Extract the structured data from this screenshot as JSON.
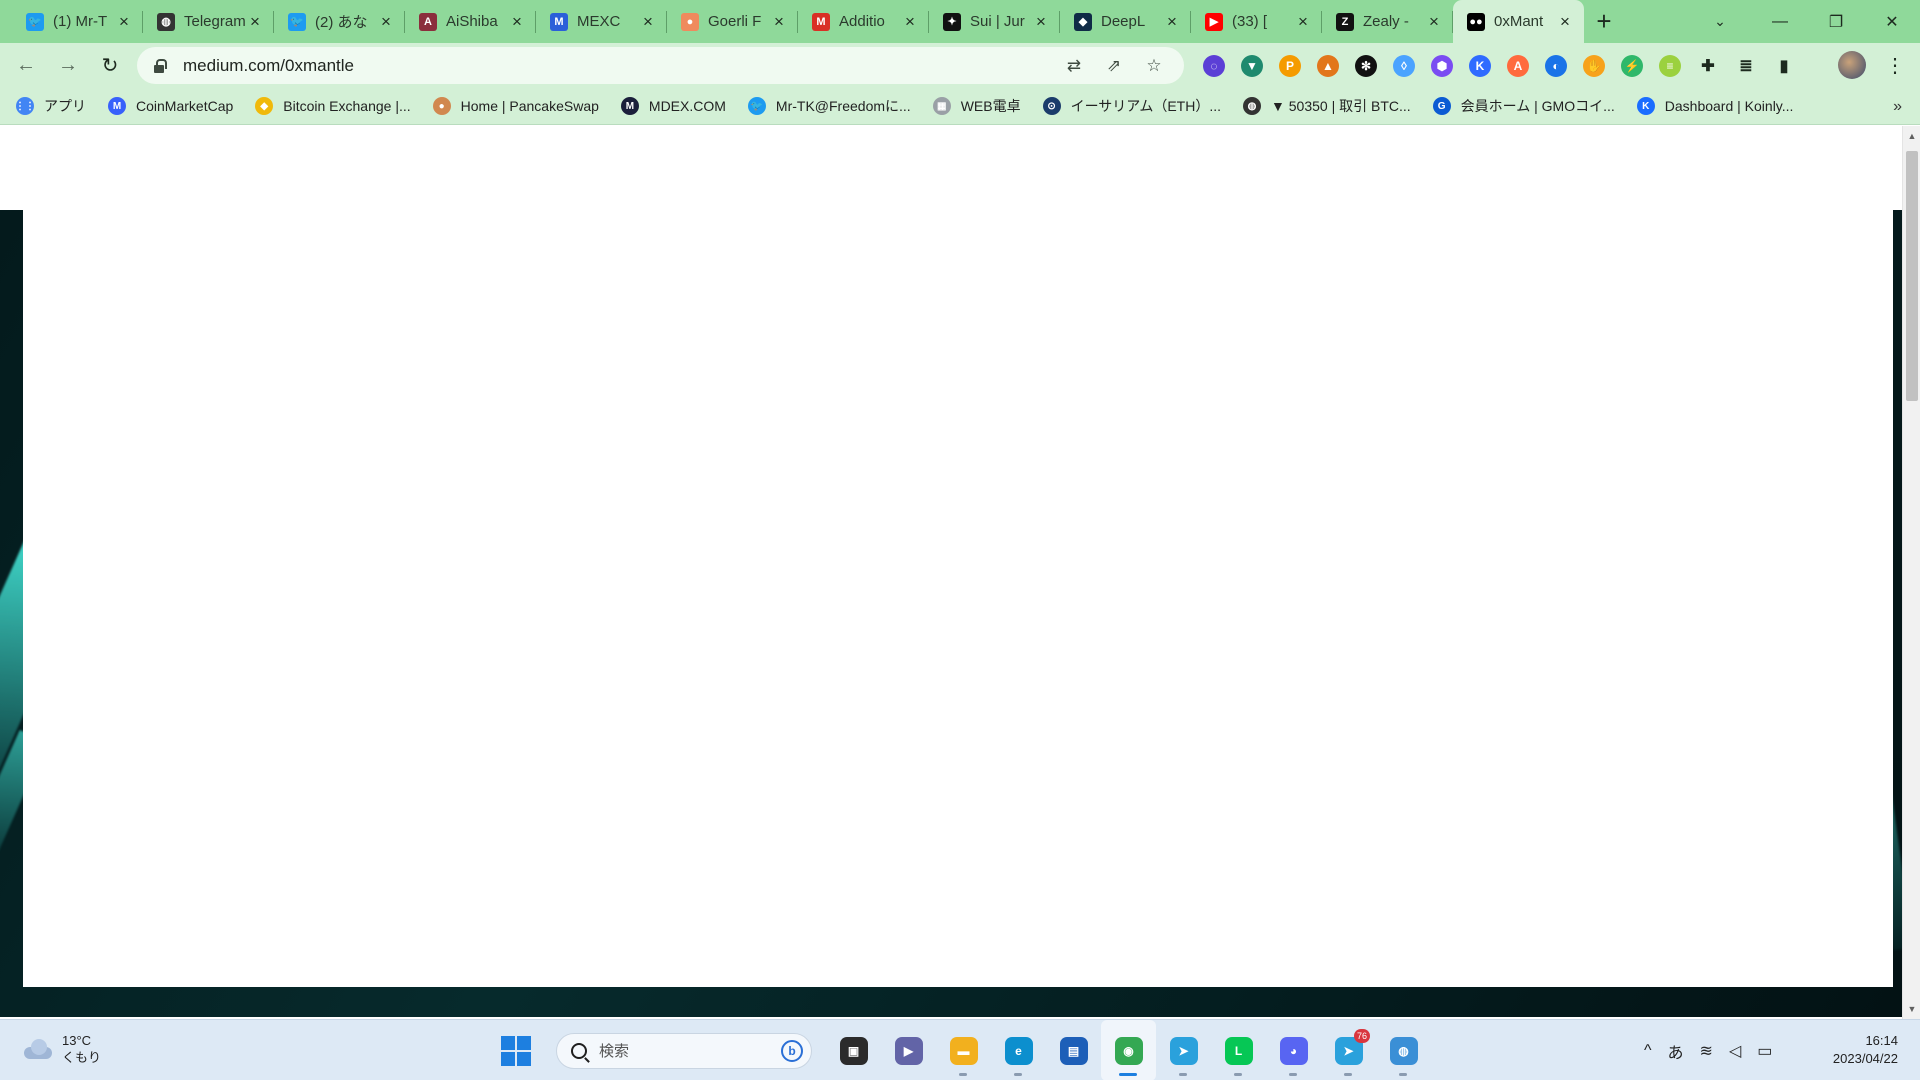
{
  "browser": {
    "tabs": [
      {
        "label": "(1) Mr-T",
        "icon": "twitter-icon",
        "color": "#1d9bf0",
        "glyph": "🐦"
      },
      {
        "label": "Telegram",
        "icon": "globe-icon",
        "color": "#333333",
        "glyph": "◍"
      },
      {
        "label": "(2) あな",
        "icon": "twitter-icon",
        "color": "#1d9bf0",
        "glyph": "🐦"
      },
      {
        "label": "AiShiba",
        "icon": "aishiba-icon",
        "color": "#8b2e3c",
        "glyph": "A"
      },
      {
        "label": "MEXC",
        "icon": "mexc-icon",
        "color": "#2b5fd9",
        "glyph": "M"
      },
      {
        "label": "Goerli F",
        "icon": "faucet-icon",
        "color": "#f08a5d",
        "glyph": "●"
      },
      {
        "label": "Additio",
        "icon": "gmail-icon",
        "color": "#d93025",
        "glyph": "M"
      },
      {
        "label": "Sui | Jur",
        "icon": "sui-icon",
        "color": "#111111",
        "glyph": "✦"
      },
      {
        "label": "DeepL",
        "icon": "deepl-icon",
        "color": "#0f2b46",
        "glyph": "◆"
      },
      {
        "label": "(33) [",
        "icon": "youtube-icon",
        "color": "#ff0000",
        "glyph": "▶"
      },
      {
        "label": "Zealy -",
        "icon": "zealy-icon",
        "color": "#111111",
        "glyph": "Z"
      },
      {
        "label": "0xMant",
        "icon": "medium-icon",
        "color": "#000000",
        "glyph": "●●",
        "active": true
      }
    ],
    "new_tab": "+",
    "tab_search": "⌄",
    "window_controls": {
      "minimize": "—",
      "maximize": "❐",
      "close": "✕"
    }
  },
  "toolbar": {
    "back": "←",
    "forward": "→",
    "reload": "↻",
    "url": "medium.com/0xmantle",
    "omni_actions": [
      "translate-icon",
      "share-icon",
      "bookmark-star-icon"
    ],
    "omni_glyphs": [
      "⇄",
      "⇗",
      "☆"
    ],
    "extensions": [
      {
        "name": "ext-purple-ring-icon",
        "color": "#5b3fd6",
        "glyph": "◌"
      },
      {
        "name": "ext-fox-icon",
        "color": "#1e8a6e",
        "glyph": "▼"
      },
      {
        "name": "ext-orange-p-icon",
        "color": "#f59b00",
        "glyph": "P"
      },
      {
        "name": "metamask-icon",
        "color": "#e2761b",
        "glyph": "▲"
      },
      {
        "name": "ext-black-asterisk-icon",
        "color": "#111111",
        "glyph": "✻"
      },
      {
        "name": "ext-drop-icon",
        "color": "#4aa3ff",
        "glyph": "◊"
      },
      {
        "name": "ext-violet-hex-icon",
        "color": "#7a4cf2",
        "glyph": "⬢"
      },
      {
        "name": "keplr-icon",
        "color": "#2f6bff",
        "glyph": "K"
      },
      {
        "name": "ext-a-icon",
        "color": "#ff6a3d",
        "glyph": "A"
      },
      {
        "name": "ext-blue-orb-icon",
        "color": "#1a73e8",
        "glyph": "◐"
      },
      {
        "name": "ext-hand-icon",
        "color": "#f7a21b",
        "glyph": "✋"
      },
      {
        "name": "ext-lightning-icon",
        "color": "#2fb86a",
        "glyph": "⚡"
      },
      {
        "name": "ext-layer-icon",
        "color": "#9bd13e",
        "glyph": "≡"
      },
      {
        "name": "extensions-puzzle-icon",
        "color": "#1d2a1f",
        "glyph": "✚"
      },
      {
        "name": "media-queue-icon",
        "color": "#1d2a1f",
        "glyph": "≣"
      },
      {
        "name": "side-panel-icon",
        "color": "#1d2a1f",
        "glyph": "▮"
      }
    ],
    "menu": "⋮"
  },
  "bookmarks": [
    {
      "label": "アプリ",
      "icon": "apps-grid-icon",
      "color": "#4285f4",
      "glyph": "⋮⋮"
    },
    {
      "label": "CoinMarketCap",
      "icon": "coinmarketcap-icon",
      "color": "#3861fb",
      "glyph": "M"
    },
    {
      "label": "Bitcoin Exchange |...",
      "icon": "binance-icon",
      "color": "#f0b90b",
      "glyph": "◆"
    },
    {
      "label": "Home | PancakeSwap",
      "icon": "pancakeswap-icon",
      "color": "#d1884f",
      "glyph": "●"
    },
    {
      "label": "MDEX.COM",
      "icon": "mdex-icon",
      "color": "#1b1f3b",
      "glyph": "M"
    },
    {
      "label": "Mr-TK@Freedomに...",
      "icon": "twitter-icon",
      "color": "#1d9bf0",
      "glyph": "🐦"
    },
    {
      "label": "WEB電卓",
      "icon": "calculator-icon",
      "color": "#9aa0a6",
      "glyph": "▦"
    },
    {
      "label": "イーサリアム（ETH）...",
      "icon": "eth-chart-icon",
      "color": "#1b3c6b",
      "glyph": "⊙"
    },
    {
      "label": "▼ 50350 | 取引 BTC...",
      "icon": "globe-icon",
      "color": "#333333",
      "glyph": "◍"
    },
    {
      "label": "会員ホーム | GMOコイ...",
      "icon": "gmo-icon",
      "color": "#0b5bd3",
      "glyph": "G"
    },
    {
      "label": "Dashboard | Koinly...",
      "icon": "koinly-icon",
      "color": "#1a6dff",
      "glyph": "K"
    }
  ],
  "bookmarks_more": "»",
  "taskbar": {
    "weather": {
      "temp": "13°C",
      "condition": "くもり"
    },
    "search_placeholder": "検索",
    "apps": [
      {
        "name": "task-view-icon",
        "color": "#2b2b2b",
        "glyph": "▣"
      },
      {
        "name": "teams-chat-icon",
        "color": "#6264a7",
        "glyph": "▶"
      },
      {
        "name": "file-explorer-icon",
        "color": "#f2b01e",
        "glyph": "▬"
      },
      {
        "name": "edge-icon",
        "color": "#0c8fce",
        "glyph": "e"
      },
      {
        "name": "microsoft-store-icon",
        "color": "#1d5fb8",
        "glyph": "▤"
      },
      {
        "name": "chrome-icon",
        "color": "#34a853",
        "glyph": "◉",
        "active": true
      },
      {
        "name": "telegram-icon",
        "color": "#2aa1dc",
        "glyph": "➤"
      },
      {
        "name": "line-icon",
        "color": "#06c755",
        "glyph": "L"
      },
      {
        "name": "discord-icon",
        "color": "#5865f2",
        "glyph": "◕"
      },
      {
        "name": "telegram-alt-icon",
        "color": "#2aa1dc",
        "glyph": "➤",
        "badge": "76"
      },
      {
        "name": "network-globe-icon",
        "color": "#3a8fd6",
        "glyph": "◍"
      }
    ],
    "tray": {
      "chevron": "^",
      "ime": "あ",
      "wifi": "≋",
      "volume": "◁",
      "battery": "▭"
    },
    "clock": {
      "time": "16:14",
      "date": "2023/04/22"
    }
  }
}
